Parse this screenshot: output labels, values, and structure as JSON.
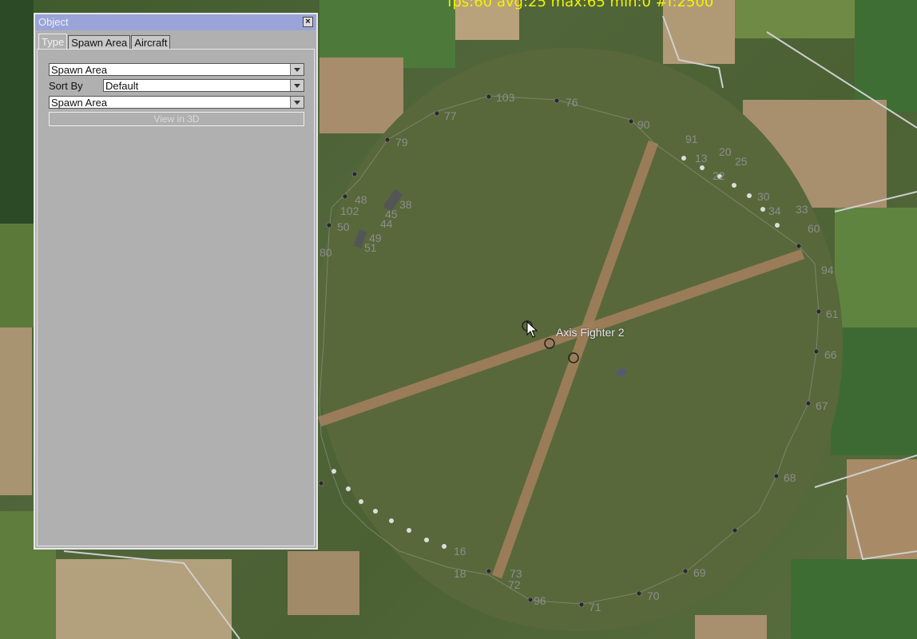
{
  "hud": {
    "fps_text": "fps:60 avg:25 max:65 min:0 #f:2500"
  },
  "map": {
    "airfield_label": "Axis Fighter 2",
    "waypoint_labels": [
      "103",
      "76",
      "77",
      "79",
      "80",
      "90",
      "91",
      "20",
      "33",
      "60",
      "61",
      "66",
      "67",
      "68",
      "69",
      "70",
      "71",
      "96",
      "72",
      "73",
      "18",
      "16",
      "94",
      "49",
      "51",
      "50",
      "102",
      "44",
      "45",
      "48",
      "38",
      "34",
      "30",
      "25",
      "22",
      "13"
    ]
  },
  "dialog": {
    "title": "Object",
    "tabs": [
      {
        "label": "Type",
        "active": true
      },
      {
        "label": "Spawn Area",
        "active": false
      },
      {
        "label": "Aircraft",
        "active": false
      }
    ],
    "type_select": {
      "value": "Spawn Area"
    },
    "sort_by": {
      "label": "Sort By",
      "value": "Default"
    },
    "spawn_select": {
      "value": "Spawn Area"
    },
    "view_button": {
      "label": "View in 3D"
    }
  },
  "colors": {
    "title_bar": "#9aa4d8",
    "panel_bg": "#b0b0b0",
    "hud_text": "#f2f200",
    "runway": "#a27f5c"
  }
}
